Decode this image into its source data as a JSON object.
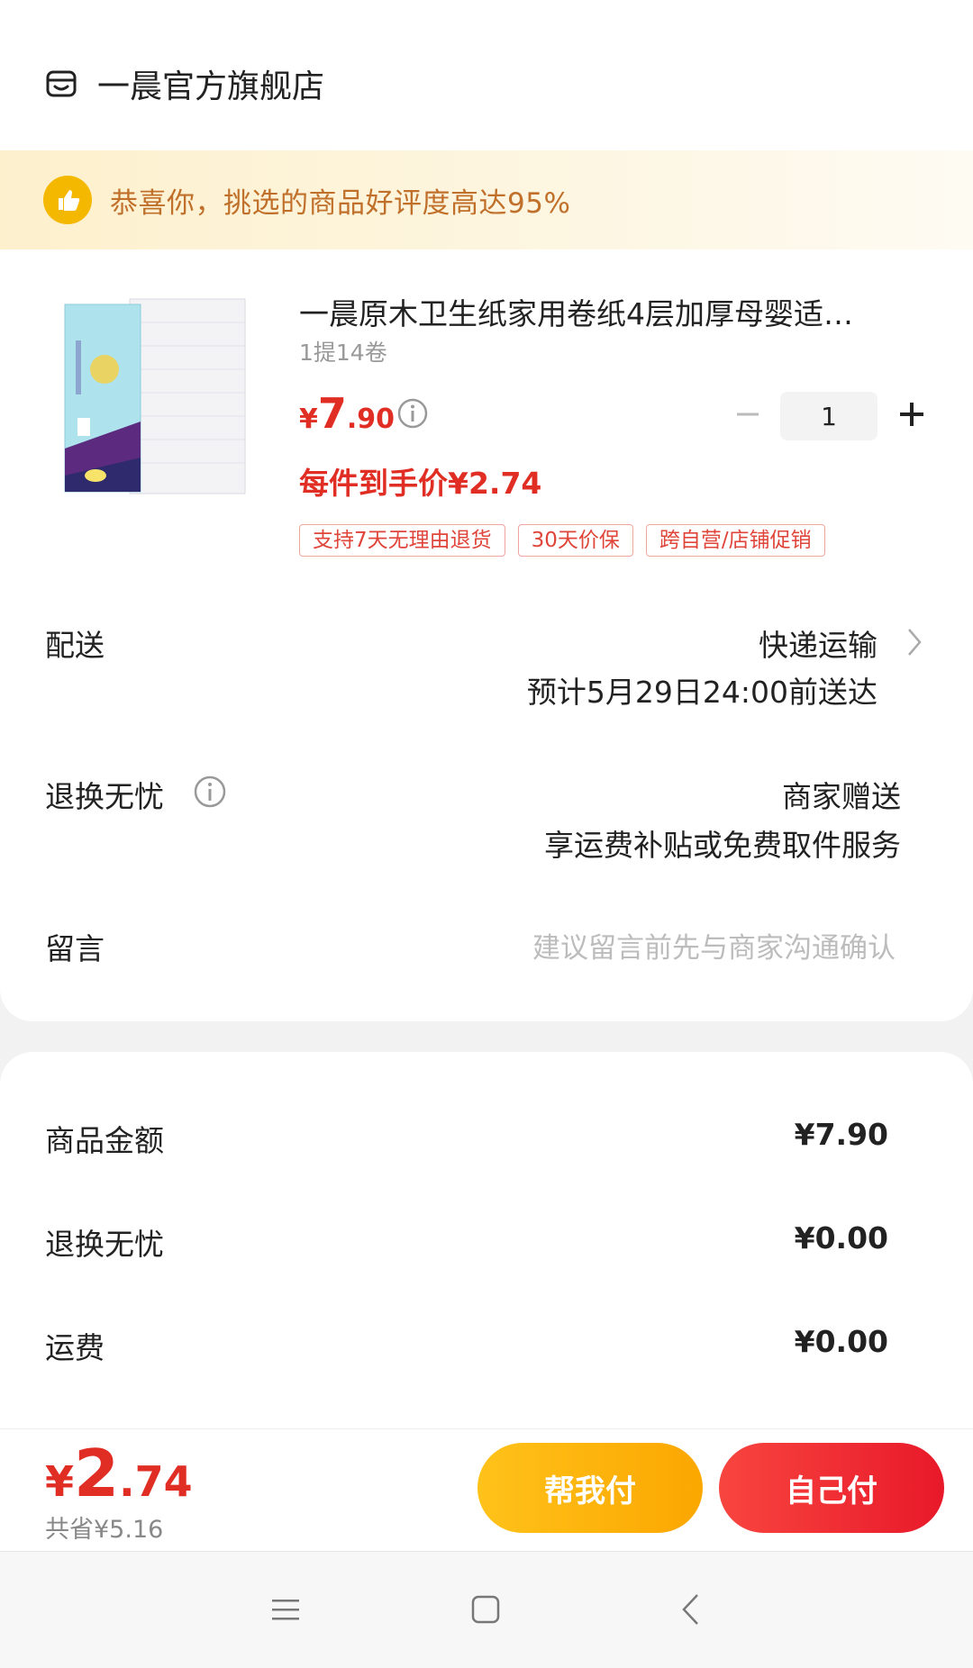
{
  "store": {
    "name": "一晨官方旗舰店",
    "icon": "store-icon"
  },
  "banner": {
    "text": "恭喜你，挑选的商品好评度高达95%",
    "icon": "thumbs-up-icon"
  },
  "product": {
    "title": "一晨原木卫生纸家用卷纸4层加厚母婴适…",
    "spec": "1提14卷",
    "price_yen": "¥",
    "price_int": "7",
    "price_dec": ".90",
    "quantity": "1",
    "final_price": "每件到手价¥2.74",
    "tags": [
      "支持7天无理由退货",
      "30天价保",
      "跨自营/店铺促销"
    ]
  },
  "delivery": {
    "label": "配送",
    "method": "快递运输",
    "eta": "预计5月29日24:00前送达"
  },
  "return": {
    "label": "退换无忧",
    "value": "商家赠送",
    "desc": "享运费补贴或免费取件服务"
  },
  "message": {
    "label": "留言",
    "placeholder": "建议留言前先与商家沟通确认"
  },
  "summary": [
    {
      "label": "商品金额",
      "value": "¥7.90"
    },
    {
      "label": "退换无忧",
      "value": "¥0.00"
    },
    {
      "label": "运费",
      "value": "¥0.00"
    }
  ],
  "paybar": {
    "total_yen": "¥",
    "total_int": "2",
    "total_dec": ".74",
    "saved": "共省¥5.16",
    "help_pay": "帮我付",
    "self_pay": "自己付"
  },
  "colors": {
    "accent_red": "#e02e24",
    "banner_text": "#c0702a",
    "help_btn": "#fba700",
    "self_btn": "#e8192a"
  }
}
